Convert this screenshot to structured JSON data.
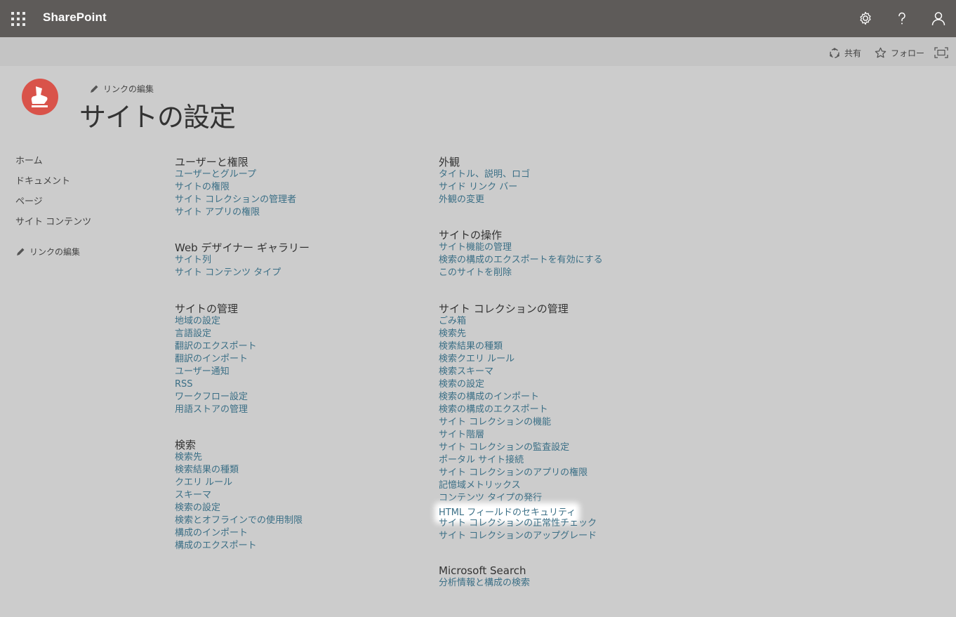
{
  "suitebar": {
    "brand": "SharePoint"
  },
  "actions": {
    "share": "共有",
    "follow": "フォロー"
  },
  "header": {
    "edit_links": "リンクの編集",
    "title": "サイトの設定"
  },
  "leftnav": {
    "items": [
      "ホーム",
      "ドキュメント",
      "ページ",
      "サイト コンテンツ"
    ],
    "edit_links": "リンクの編集"
  },
  "columns": [
    {
      "sections": [
        {
          "title": "ユーザーと権限",
          "links": [
            "ユーザーとグループ",
            "サイトの権限",
            "サイト コレクションの管理者",
            "サイト アプリの権限"
          ]
        },
        {
          "title": "Web デザイナー ギャラリー",
          "links": [
            "サイト列",
            "サイト コンテンツ タイプ"
          ]
        },
        {
          "title": "サイトの管理",
          "links": [
            "地域の設定",
            "言語設定",
            "翻訳のエクスポート",
            "翻訳のインポート",
            "ユーザー通知",
            "RSS",
            "ワークフロー設定",
            "用語ストアの管理"
          ]
        },
        {
          "title": "検索",
          "links": [
            "検索先",
            "検索結果の種類",
            "クエリ ルール",
            "スキーマ",
            "検索の設定",
            "検索とオフラインでの使用制限",
            "構成のインポート",
            "構成のエクスポート"
          ]
        }
      ]
    },
    {
      "sections": [
        {
          "title": "外観",
          "links": [
            "タイトル、説明、ロゴ",
            "サイド リンク バー",
            "外観の変更"
          ]
        },
        {
          "title": "サイトの操作",
          "links": [
            "サイト機能の管理",
            "検索の構成のエクスポートを有効にする",
            "このサイトを削除"
          ]
        },
        {
          "title": "サイト コレクションの管理",
          "links": [
            "ごみ箱",
            "検索先",
            "検索結果の種類",
            "検索クエリ ルール",
            "検索スキーマ",
            "検索の設定",
            "検索の構成のインポート",
            "検索の構成のエクスポート",
            "サイト コレクションの機能",
            "サイト階層",
            "サイト コレクションの監査設定",
            "ポータル サイト接続",
            "サイト コレクションのアプリの権限",
            "記憶域メトリックス",
            "コンテンツ タイプの発行",
            "HTML フィールドのセキュリティ",
            "サイト コレクションの正常性チェック",
            "サイト コレクションのアップグレード"
          ]
        },
        {
          "title": "Microsoft Search",
          "links": [
            "分析情報と構成の検索"
          ]
        }
      ]
    }
  ],
  "highlighted_link": "HTML フィールドのセキュリティ",
  "colors": {
    "suitebar": "#5e5b59",
    "background": "#cccccc",
    "link": "#3b6f86",
    "logo": "#d9534a"
  }
}
